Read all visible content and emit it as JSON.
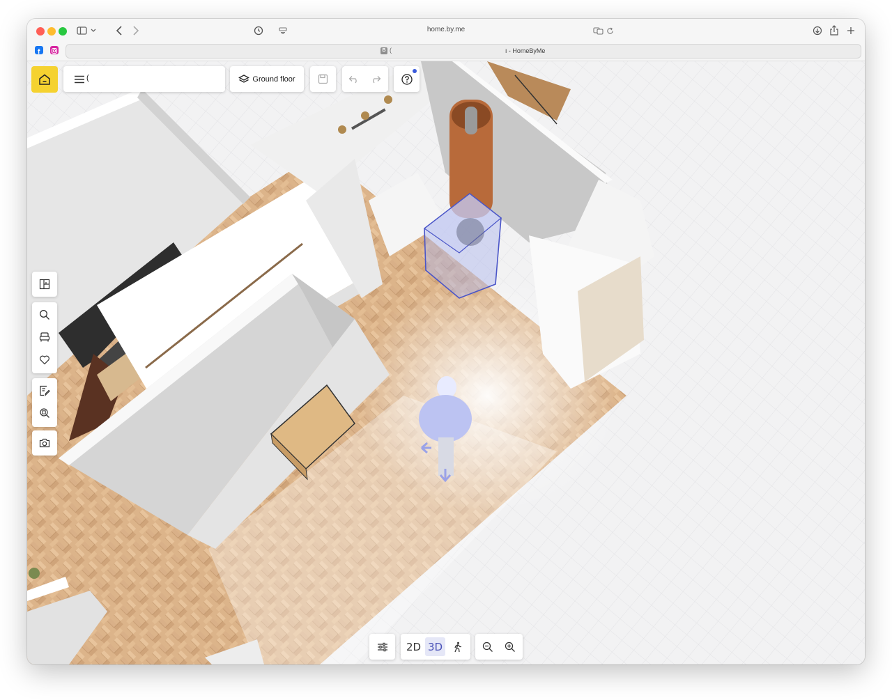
{
  "browser": {
    "url": "home.by.me",
    "tab_title": "ו - HomeByMe",
    "tab_favicon_letter": "B",
    "tab_favicon_trailing": "(",
    "traffic_colors": [
      "#ff5f57",
      "#febc2e",
      "#28c840"
    ]
  },
  "toolbar": {
    "home_icon": "home-icon",
    "menu_icon": "hamburger-icon",
    "menu_label": "(",
    "floor_selector_label": "Ground floor",
    "floor_icon": "layers-icon",
    "save_icon": "floppy-icon",
    "undo_icon": "undo-icon",
    "redo_icon": "redo-icon",
    "help_icon": "help-circle-icon",
    "help_badge_color": "#3b5bdb",
    "accent_color": "#f5d230"
  },
  "left_tools": [
    {
      "icon": "floorplan-icon"
    },
    {
      "icon": "search-icon"
    },
    {
      "icon": "armchair-icon"
    },
    {
      "icon": "heart-icon"
    },
    {
      "icon": "edit-note-icon"
    },
    {
      "icon": "search-object-icon"
    },
    {
      "icon": "camera-icon"
    }
  ],
  "bottom_bar": {
    "settings_icon": "sliders-icon",
    "view_2d": "2D",
    "view_3d": "3D",
    "active_view": "3D",
    "walk_icon": "walk-icon",
    "zoom_out_icon": "zoom-out-icon",
    "zoom_in_icon": "zoom-in-icon"
  }
}
